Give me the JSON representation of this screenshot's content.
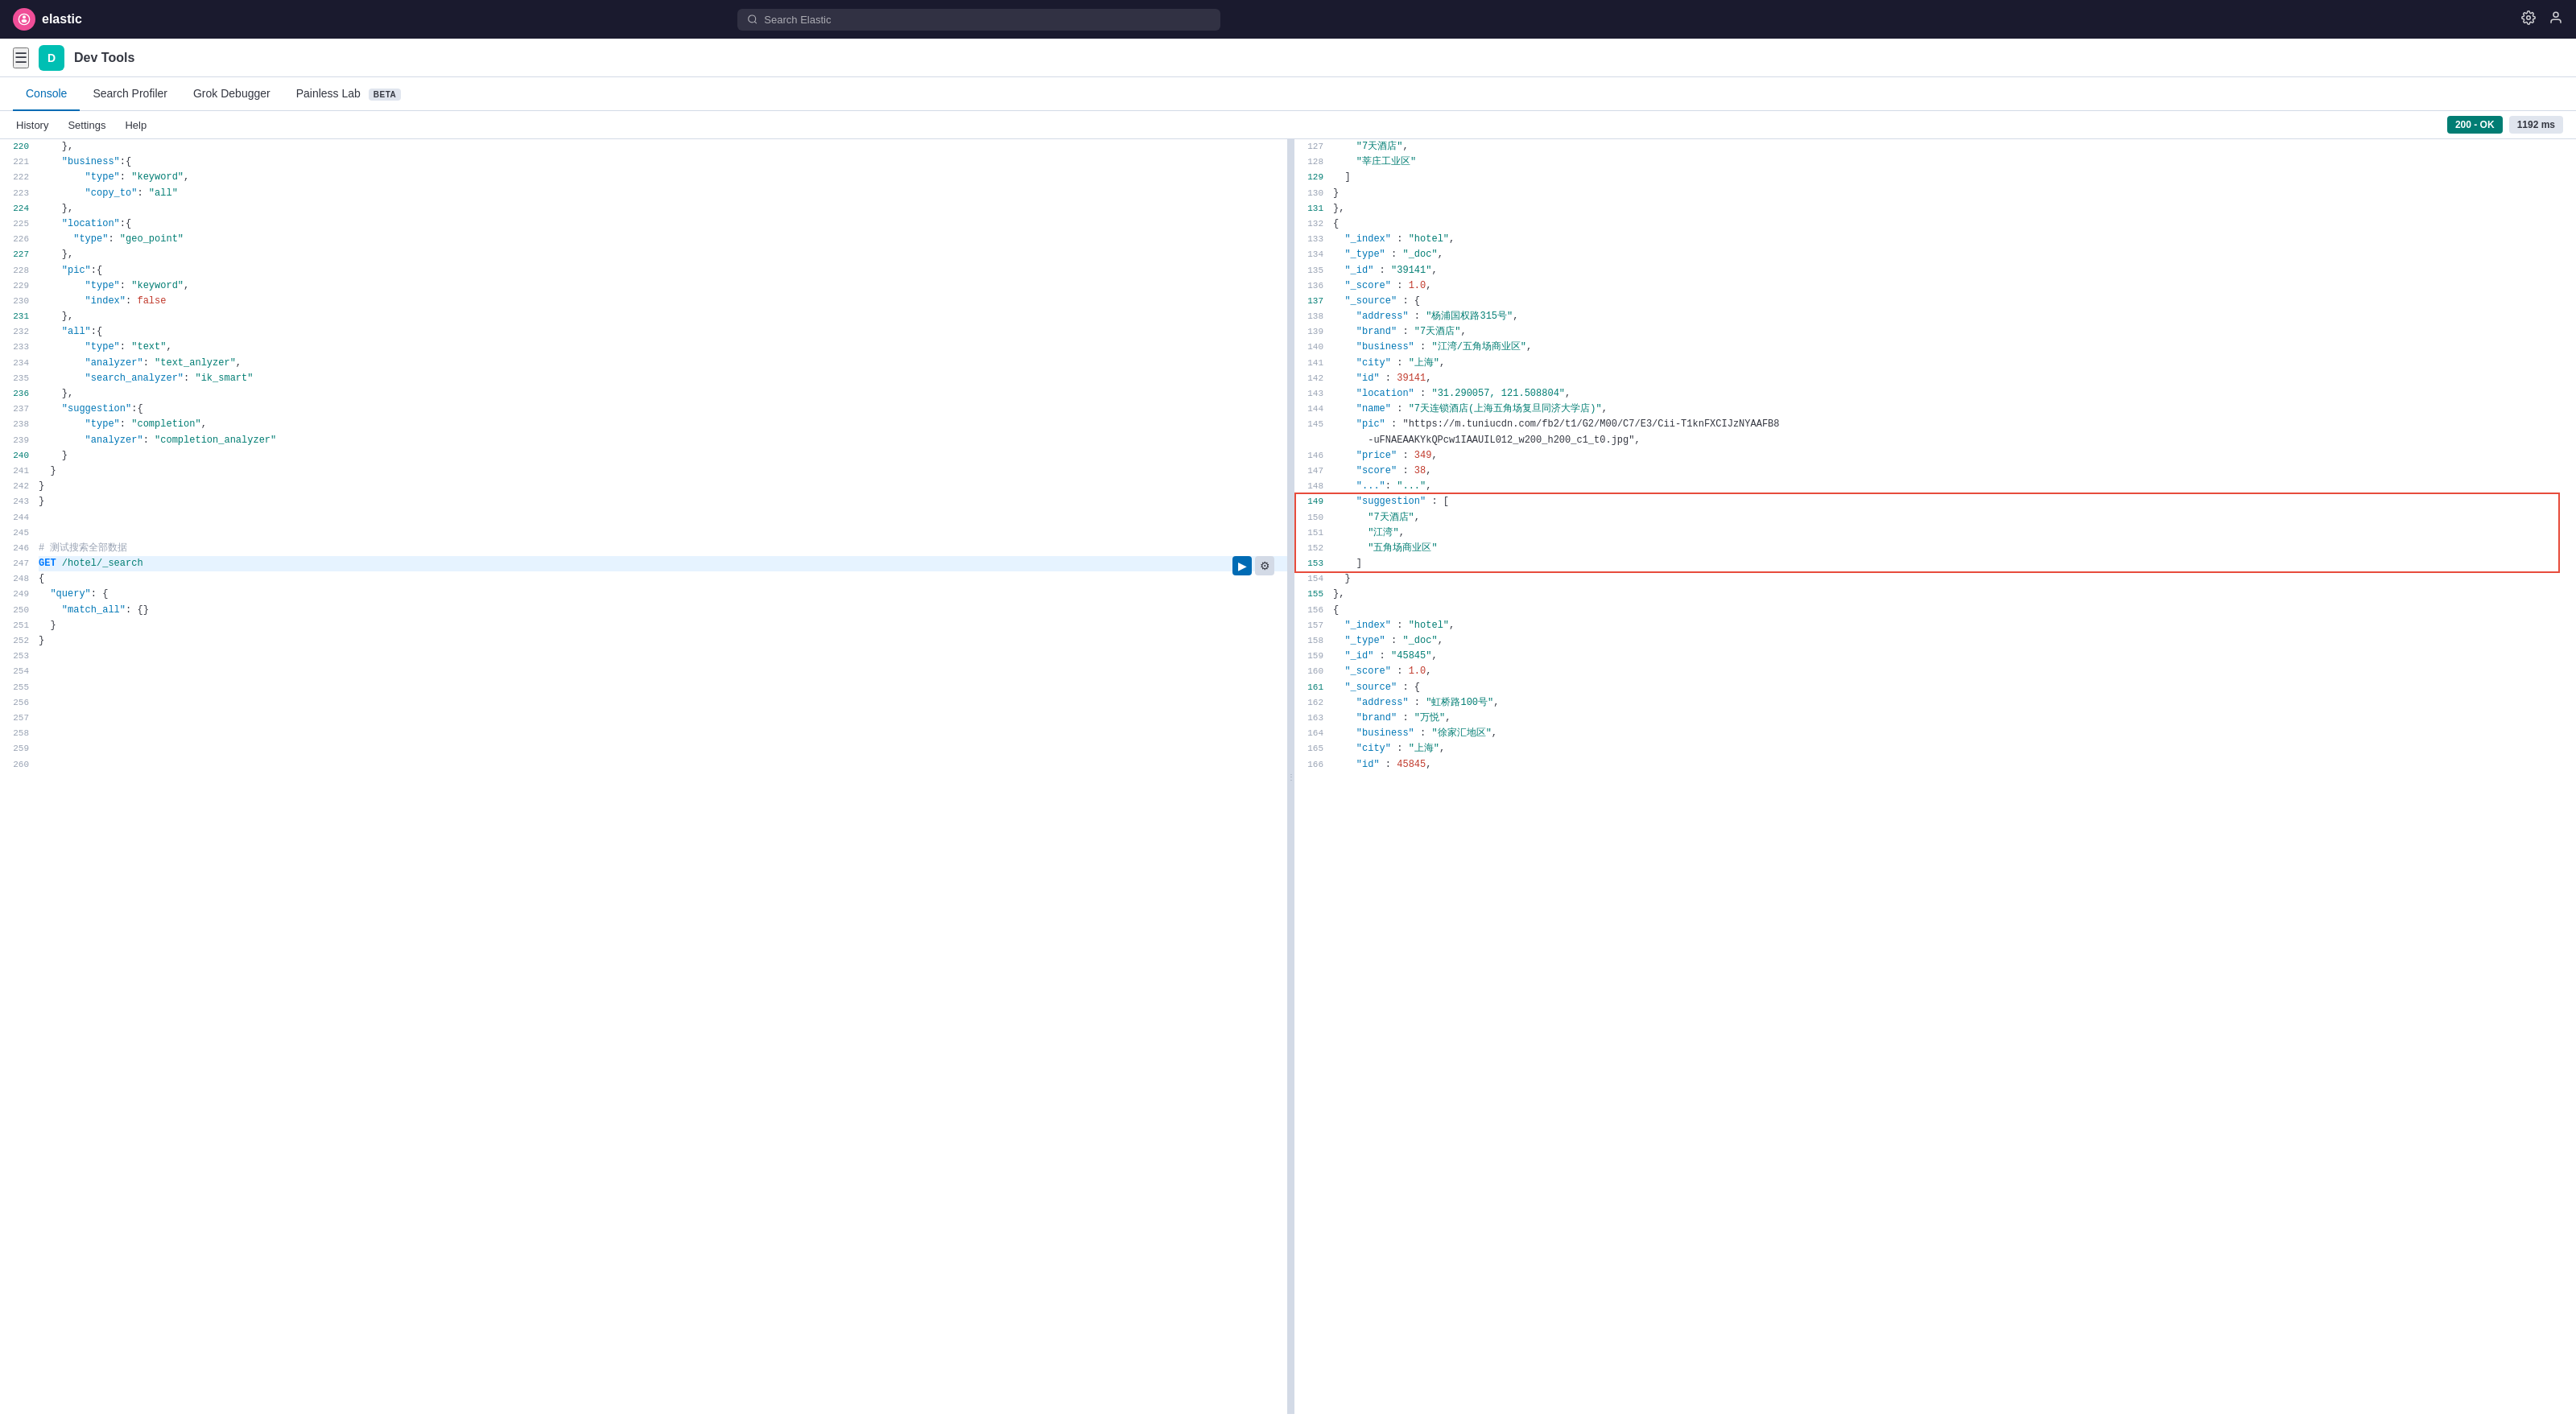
{
  "topnav": {
    "logo_text": "elastic",
    "logo_letter": "e",
    "search_placeholder": "Search Elastic",
    "icon1": "⚙",
    "icon2": "👤"
  },
  "appheader": {
    "dev_letter": "D",
    "title": "Dev Tools"
  },
  "tabs": [
    {
      "id": "console",
      "label": "Console",
      "active": true
    },
    {
      "id": "search-profiler",
      "label": "Search Profiler",
      "active": false
    },
    {
      "id": "grok-debugger",
      "label": "Grok Debugger",
      "active": false
    },
    {
      "id": "painless-lab",
      "label": "Painless Lab",
      "active": false,
      "beta": true
    }
  ],
  "subtoolbar": {
    "history": "History",
    "settings": "Settings",
    "help": "Help",
    "status": "200 - OK",
    "time": "1192 ms"
  },
  "left_lines": [
    {
      "num": "220",
      "modified": true,
      "content": "    },"
    },
    {
      "num": "221",
      "modified": false,
      "content": "    \"business\":{"
    },
    {
      "num": "222",
      "modified": false,
      "content": "        \"type\": \"keyword\","
    },
    {
      "num": "223",
      "modified": false,
      "content": "        \"copy_to\": \"all\""
    },
    {
      "num": "224",
      "modified": true,
      "content": "    },"
    },
    {
      "num": "225",
      "modified": false,
      "content": "    \"location\":{"
    },
    {
      "num": "226",
      "modified": false,
      "content": "      \"type\": \"geo_point\""
    },
    {
      "num": "227",
      "modified": true,
      "content": "    },"
    },
    {
      "num": "228",
      "modified": false,
      "content": "    \"pic\":{"
    },
    {
      "num": "229",
      "modified": false,
      "content": "        \"type\": \"keyword\","
    },
    {
      "num": "230",
      "modified": false,
      "content": "        \"index\": false"
    },
    {
      "num": "231",
      "modified": true,
      "content": "    },"
    },
    {
      "num": "232",
      "modified": false,
      "content": "    \"all\":{"
    },
    {
      "num": "233",
      "modified": false,
      "content": "        \"type\": \"text\","
    },
    {
      "num": "234",
      "modified": false,
      "content": "        \"analyzer\": \"text_anlyzer\","
    },
    {
      "num": "235",
      "modified": false,
      "content": "        \"search_analyzer\": \"ik_smart\""
    },
    {
      "num": "236",
      "modified": true,
      "content": "    },"
    },
    {
      "num": "237",
      "modified": false,
      "content": "    \"suggestion\":{"
    },
    {
      "num": "238",
      "modified": false,
      "content": "        \"type\": \"completion\","
    },
    {
      "num": "239",
      "modified": false,
      "content": "        \"analyzer\": \"completion_analyzer\""
    },
    {
      "num": "240",
      "modified": true,
      "content": "    }"
    },
    {
      "num": "241",
      "modified": false,
      "content": "  }"
    },
    {
      "num": "242",
      "modified": false,
      "content": "}"
    },
    {
      "num": "243",
      "modified": false,
      "content": "}"
    },
    {
      "num": "244",
      "modified": false,
      "content": ""
    },
    {
      "num": "245",
      "modified": false,
      "content": ""
    },
    {
      "num": "246",
      "modified": false,
      "content": "# 测试搜索全部数据"
    },
    {
      "num": "247",
      "modified": false,
      "content": "GET /hotel/_search",
      "active": true
    },
    {
      "num": "248",
      "modified": false,
      "content": "{"
    },
    {
      "num": "249",
      "modified": false,
      "content": "  \"query\": {"
    },
    {
      "num": "250",
      "modified": false,
      "content": "    \"match_all\": {}"
    },
    {
      "num": "251",
      "modified": false,
      "content": "  }"
    },
    {
      "num": "252",
      "modified": false,
      "content": "}"
    },
    {
      "num": "253",
      "modified": false,
      "content": ""
    },
    {
      "num": "254",
      "modified": false,
      "content": ""
    },
    {
      "num": "255",
      "modified": false,
      "content": ""
    },
    {
      "num": "256",
      "modified": false,
      "content": ""
    },
    {
      "num": "257",
      "modified": false,
      "content": ""
    },
    {
      "num": "258",
      "modified": false,
      "content": ""
    },
    {
      "num": "259",
      "modified": false,
      "content": ""
    },
    {
      "num": "260",
      "modified": false,
      "content": ""
    }
  ],
  "right_lines": [
    {
      "num": "127",
      "modified": false,
      "content": "    \"7天酒店\","
    },
    {
      "num": "128",
      "modified": false,
      "content": "    \"莘庄工业区\""
    },
    {
      "num": "129",
      "modified": true,
      "content": "  ]"
    },
    {
      "num": "130",
      "modified": false,
      "content": "}"
    },
    {
      "num": "131",
      "modified": true,
      "content": "},"
    },
    {
      "num": "132",
      "modified": false,
      "content": "{"
    },
    {
      "num": "133",
      "modified": false,
      "content": "  \"_index\" : \"hotel\","
    },
    {
      "num": "134",
      "modified": false,
      "content": "  \"_type\" : \"_doc\","
    },
    {
      "num": "135",
      "modified": false,
      "content": "  \"_id\" : \"39141\","
    },
    {
      "num": "136",
      "modified": false,
      "content": "  \"_score\" : 1.0,"
    },
    {
      "num": "137",
      "modified": true,
      "content": "  \"_source\" : {"
    },
    {
      "num": "138",
      "modified": false,
      "content": "    \"address\" : \"杨浦国权路315号\","
    },
    {
      "num": "139",
      "modified": false,
      "content": "    \"brand\" : \"7天酒店\","
    },
    {
      "num": "140",
      "modified": false,
      "content": "    \"business\" : \"江湾/五角场商业区\","
    },
    {
      "num": "141",
      "modified": false,
      "content": "    \"city\" : \"上海\","
    },
    {
      "num": "142",
      "modified": false,
      "content": "    \"id\" : 39141,"
    },
    {
      "num": "143",
      "modified": false,
      "content": "    \"location\" : \"31.290057, 121.508804\","
    },
    {
      "num": "144",
      "modified": false,
      "content": "    \"name\" : \"7天连锁酒店(上海五角场复旦同济大学店)\","
    },
    {
      "num": "145",
      "modified": false,
      "content": "    \"pic\" : \"https://m.tuniucdn.com/fb2/t1/G2/M00/C7/E3/Cii-T1knFXCIJzNYAAFB8"
    },
    {
      "num": "",
      "modified": false,
      "content": "      -uFNAEAAKYkQPcw1IAAUIL012_w200_h200_c1_t0.jpg\","
    },
    {
      "num": "146",
      "modified": false,
      "content": "    \"price\" : 349,"
    },
    {
      "num": "147",
      "modified": false,
      "content": "    \"score\" : 38,"
    },
    {
      "num": "148",
      "modified": false,
      "content": "    \"...\": \"...\","
    },
    {
      "num": "149",
      "modified": true,
      "content": "    \"suggestion\" : [",
      "highlight": true
    },
    {
      "num": "150",
      "modified": false,
      "content": "      \"7天酒店\",",
      "highlight": true
    },
    {
      "num": "151",
      "modified": false,
      "content": "      \"江湾\",",
      "highlight": true
    },
    {
      "num": "152",
      "modified": false,
      "content": "      \"五角场商业区\"",
      "highlight": true
    },
    {
      "num": "153",
      "modified": true,
      "content": "    ]",
      "highlight": true
    },
    {
      "num": "154",
      "modified": false,
      "content": "  }"
    },
    {
      "num": "155",
      "modified": true,
      "content": "},"
    },
    {
      "num": "156",
      "modified": false,
      "content": "{"
    },
    {
      "num": "157",
      "modified": false,
      "content": "  \"_index\" : \"hotel\","
    },
    {
      "num": "158",
      "modified": false,
      "content": "  \"_type\" : \"_doc\","
    },
    {
      "num": "159",
      "modified": false,
      "content": "  \"_id\" : \"45845\","
    },
    {
      "num": "160",
      "modified": false,
      "content": "  \"_score\" : 1.0,"
    },
    {
      "num": "161",
      "modified": true,
      "content": "  \"_source\" : {"
    },
    {
      "num": "162",
      "modified": false,
      "content": "    \"address\" : \"虹桥路100号\","
    },
    {
      "num": "163",
      "modified": false,
      "content": "    \"brand\" : \"万悦\","
    },
    {
      "num": "164",
      "modified": false,
      "content": "    \"business\" : \"徐家汇地区\","
    },
    {
      "num": "165",
      "modified": false,
      "content": "    \"city\" : \"上海\","
    },
    {
      "num": "166",
      "modified": false,
      "content": "    \"id\" : 45845,"
    }
  ]
}
